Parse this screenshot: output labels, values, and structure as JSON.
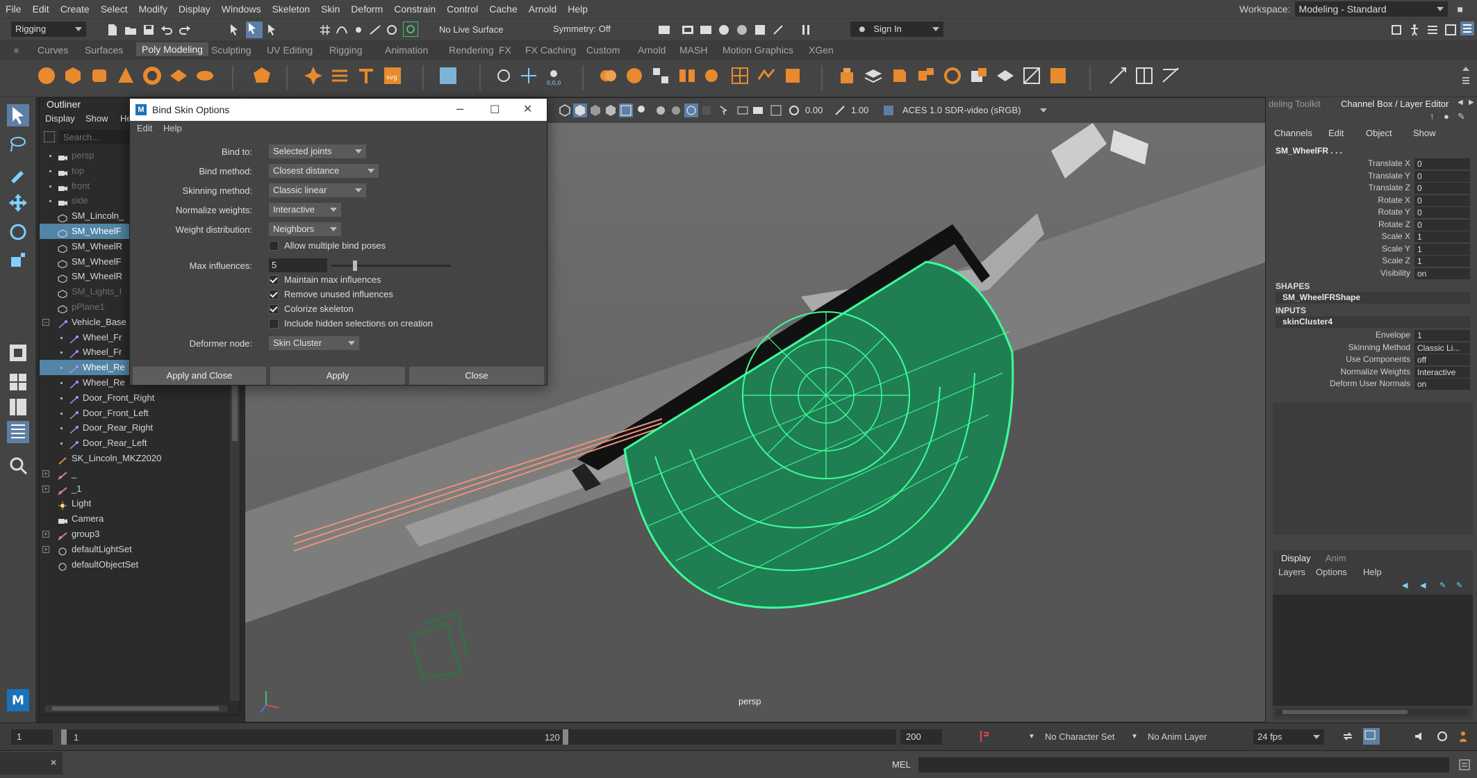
{
  "menubar": {
    "items": [
      "File",
      "Edit",
      "Create",
      "Select",
      "Modify",
      "Display",
      "Windows",
      "Skeleton",
      "Skin",
      "Deform",
      "Constrain",
      "Control",
      "Cache",
      "Arnold",
      "Help"
    ],
    "workspace_label": "Workspace:",
    "workspace_value": "Modeling - Standard"
  },
  "statusline": {
    "menuset": "Rigging",
    "live_surface": "No Live Surface",
    "symmetry": "Symmetry: Off",
    "sign_in": "Sign In"
  },
  "shelf": {
    "tabs": [
      "Curves",
      "Surfaces",
      "Poly Modeling",
      "Sculpting",
      "UV Editing",
      "Rigging",
      "Animation",
      "Rendering",
      "FX",
      "FX Caching",
      "Custom",
      "Arnold",
      "MASH",
      "Motion Graphics",
      "XGen"
    ],
    "active_tab": "Poly Modeling"
  },
  "outliner": {
    "title": "Outliner",
    "menu": [
      "Display",
      "Show",
      "He"
    ],
    "search_placeholder": "Search...",
    "rows": [
      {
        "label": "persp",
        "icon": "camera-icon",
        "dim": true
      },
      {
        "label": "top",
        "icon": "camera-icon",
        "dim": true
      },
      {
        "label": "front",
        "icon": "camera-icon",
        "dim": true
      },
      {
        "label": "side",
        "icon": "camera-icon",
        "dim": true
      },
      {
        "label": "SM_Lincoln_",
        "icon": "mesh-icon"
      },
      {
        "label": "SM_WheelF",
        "icon": "mesh-icon",
        "selected": true
      },
      {
        "label": "SM_WheelR",
        "icon": "mesh-icon"
      },
      {
        "label": "SM_WheelF",
        "icon": "mesh-icon"
      },
      {
        "label": "SM_WheelR",
        "icon": "mesh-icon"
      },
      {
        "label": "SM_Lights_I",
        "icon": "mesh-icon",
        "dim": true
      },
      {
        "label": "pPlane1",
        "icon": "mesh-icon",
        "dim": true
      },
      {
        "label": "Vehicle_Base",
        "icon": "joint-icon",
        "expanded": true
      },
      {
        "label": "Wheel_Fr",
        "icon": "joint-icon"
      },
      {
        "label": "Wheel_Fr",
        "icon": "joint-icon"
      },
      {
        "label": "Wheel_Re",
        "icon": "joint-icon",
        "selected": true
      },
      {
        "label": "Wheel_Re",
        "icon": "joint-icon"
      },
      {
        "label": "Door_Front_Right",
        "icon": "joint-icon"
      },
      {
        "label": "Door_Front_Left",
        "icon": "joint-icon"
      },
      {
        "label": "Door_Rear_Right",
        "icon": "joint-icon"
      },
      {
        "label": "Door_Rear_Left",
        "icon": "joint-icon"
      },
      {
        "label": "SK_Lincoln_MKZ2020",
        "icon": "skin-icon"
      },
      {
        "label": "_",
        "icon": "group-icon",
        "collapsed": true
      },
      {
        "label": "_1",
        "icon": "group-icon",
        "collapsed": true
      },
      {
        "label": "Light",
        "icon": "light-icon"
      },
      {
        "label": "Camera",
        "icon": "camera-icon"
      },
      {
        "label": "group3",
        "icon": "group-icon",
        "collapsed": true
      },
      {
        "label": "defaultLightSet",
        "icon": "set-icon",
        "collapsed": true
      },
      {
        "label": "defaultObjectSet",
        "icon": "set-icon"
      }
    ]
  },
  "viewport": {
    "near_value": "0.00",
    "far_value": "1.00",
    "color_space": "ACES 1.0 SDR-video (sRGB)",
    "camera_label": "persp"
  },
  "dialog": {
    "title": "Bind Skin Options",
    "menu": [
      "Edit",
      "Help"
    ],
    "fields": {
      "bind_to": {
        "label": "Bind to:",
        "value": "Selected joints"
      },
      "bind_method": {
        "label": "Bind method:",
        "value": "Closest distance"
      },
      "skinning_method": {
        "label": "Skinning method:",
        "value": "Classic linear"
      },
      "normalize_weights": {
        "label": "Normalize weights:",
        "value": "Interactive"
      },
      "weight_distribution": {
        "label": "Weight distribution:",
        "value": "Neighbors"
      },
      "max_influences": {
        "label": "Max influences:",
        "value": "5",
        "slider_fraction": 0.18
      },
      "deformer_node": {
        "label": "Deformer node:",
        "value": "Skin Cluster"
      }
    },
    "checkboxes": [
      {
        "label": "Allow multiple bind poses",
        "checked": false
      },
      {
        "label": "Maintain max influences",
        "checked": true
      },
      {
        "label": "Remove unused influences",
        "checked": true
      },
      {
        "label": "Colorize skeleton",
        "checked": true
      },
      {
        "label": "Include hidden selections on creation",
        "checked": false
      }
    ],
    "buttons": {
      "apply_close": "Apply and Close",
      "apply": "Apply",
      "close": "Close"
    }
  },
  "channelbox": {
    "tabs": [
      "deling Toolkit",
      "Channel Box / Layer Editor"
    ],
    "menu": [
      "Channels",
      "Edit",
      "Object",
      "Show"
    ],
    "object": "SM_WheelFR . . .",
    "attributes": [
      {
        "name": "Translate X",
        "value": "0"
      },
      {
        "name": "Translate Y",
        "value": "0"
      },
      {
        "name": "Translate Z",
        "value": "0"
      },
      {
        "name": "Rotate X",
        "value": "0"
      },
      {
        "name": "Rotate Y",
        "value": "0"
      },
      {
        "name": "Rotate Z",
        "value": "0"
      },
      {
        "name": "Scale X",
        "value": "1"
      },
      {
        "name": "Scale Y",
        "value": "1"
      },
      {
        "name": "Scale Z",
        "value": "1"
      },
      {
        "name": "Visibility",
        "value": "on"
      }
    ],
    "shapes_header": "SHAPES",
    "shape_name": "SM_WheelFRShape",
    "inputs_header": "INPUTS",
    "input_name": "skinCluster4",
    "input_attributes": [
      {
        "name": "Envelope",
        "value": "1"
      },
      {
        "name": "Skinning Method",
        "value": "Classic Li..."
      },
      {
        "name": "Use Components",
        "value": "off"
      },
      {
        "name": "Normalize Weights",
        "value": "Interactive"
      },
      {
        "name": "Deform User Normals",
        "value": "on"
      }
    ],
    "layer_tabs": [
      "Display",
      "Anim"
    ],
    "layer_menu": [
      "Layers",
      "Options",
      "Help"
    ]
  },
  "timeline": {
    "start": "1",
    "range_start": "1",
    "range_end": "120",
    "end": "200",
    "character_set": "No Character Set",
    "anim_layer": "No Anim Layer",
    "fps": "24 fps"
  },
  "cmdline": {
    "label": "MEL"
  },
  "colors": {
    "selection": "#5285a6",
    "wireframe": "#3dff9a",
    "joint": "#e8937a"
  }
}
